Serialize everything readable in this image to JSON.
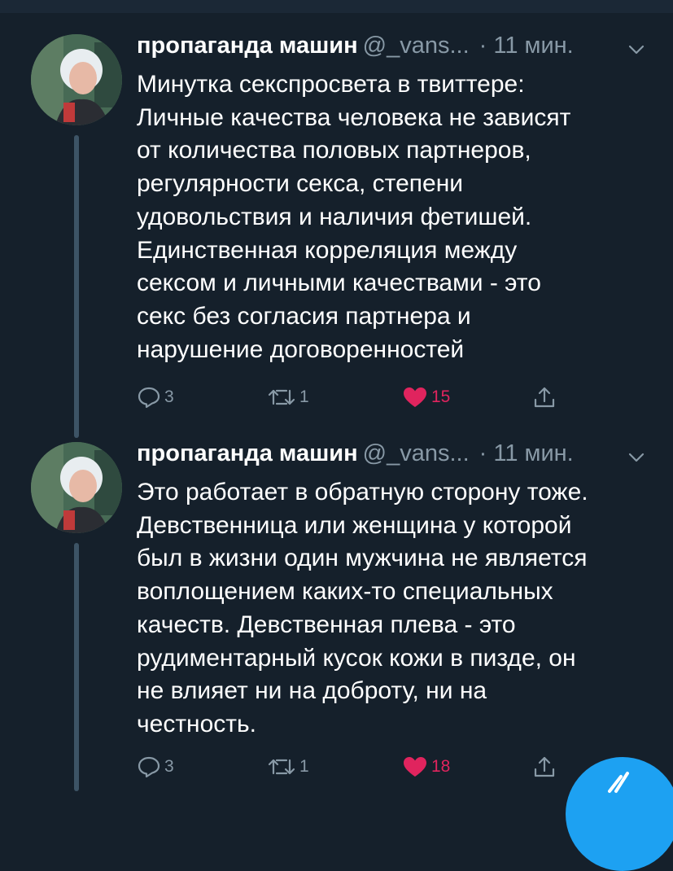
{
  "colors": {
    "background": "#15202b",
    "secondary_text": "#8899a6",
    "like": "#e0245e",
    "accent": "#1da1f2"
  },
  "tweets": [
    {
      "name": "пропаганда машин",
      "handle": "@_vans...",
      "time": "· 11 мин.",
      "text": "Минутка секспросвета в твиттере:\nЛичные качества человека не зависят\nот количества половых партнеров,\nрегулярности секса, степени\nудовольствия и наличия фетишей.\nЕдинственная корреляция между\nсексом и личными качествами - это\nсекс без согласия партнера и\nнарушение договоренностей",
      "replies": "3",
      "retweets": "1",
      "likes": "15"
    },
    {
      "name": "пропаганда машин",
      "handle": "@_vans...",
      "time": "· 11 мин.",
      "text": "Это работает в обратную сторону тоже.\nДевственница или женщина у которой\nбыл в жизни один мужчина не является\nвоплощением каких-то специальных\nкачеств. Девственная плева - это\nрудиментарный кусок кожи в пизде, он\nне влияет ни на доброту, ни на\nчестность.",
      "replies": "3",
      "retweets": "1",
      "likes": "18"
    }
  ],
  "icons": {
    "reply": "reply-icon",
    "retweet": "retweet-icon",
    "like": "heart-icon",
    "share": "share-icon",
    "caret": "chevron-down-icon",
    "compose": "compose-button"
  }
}
